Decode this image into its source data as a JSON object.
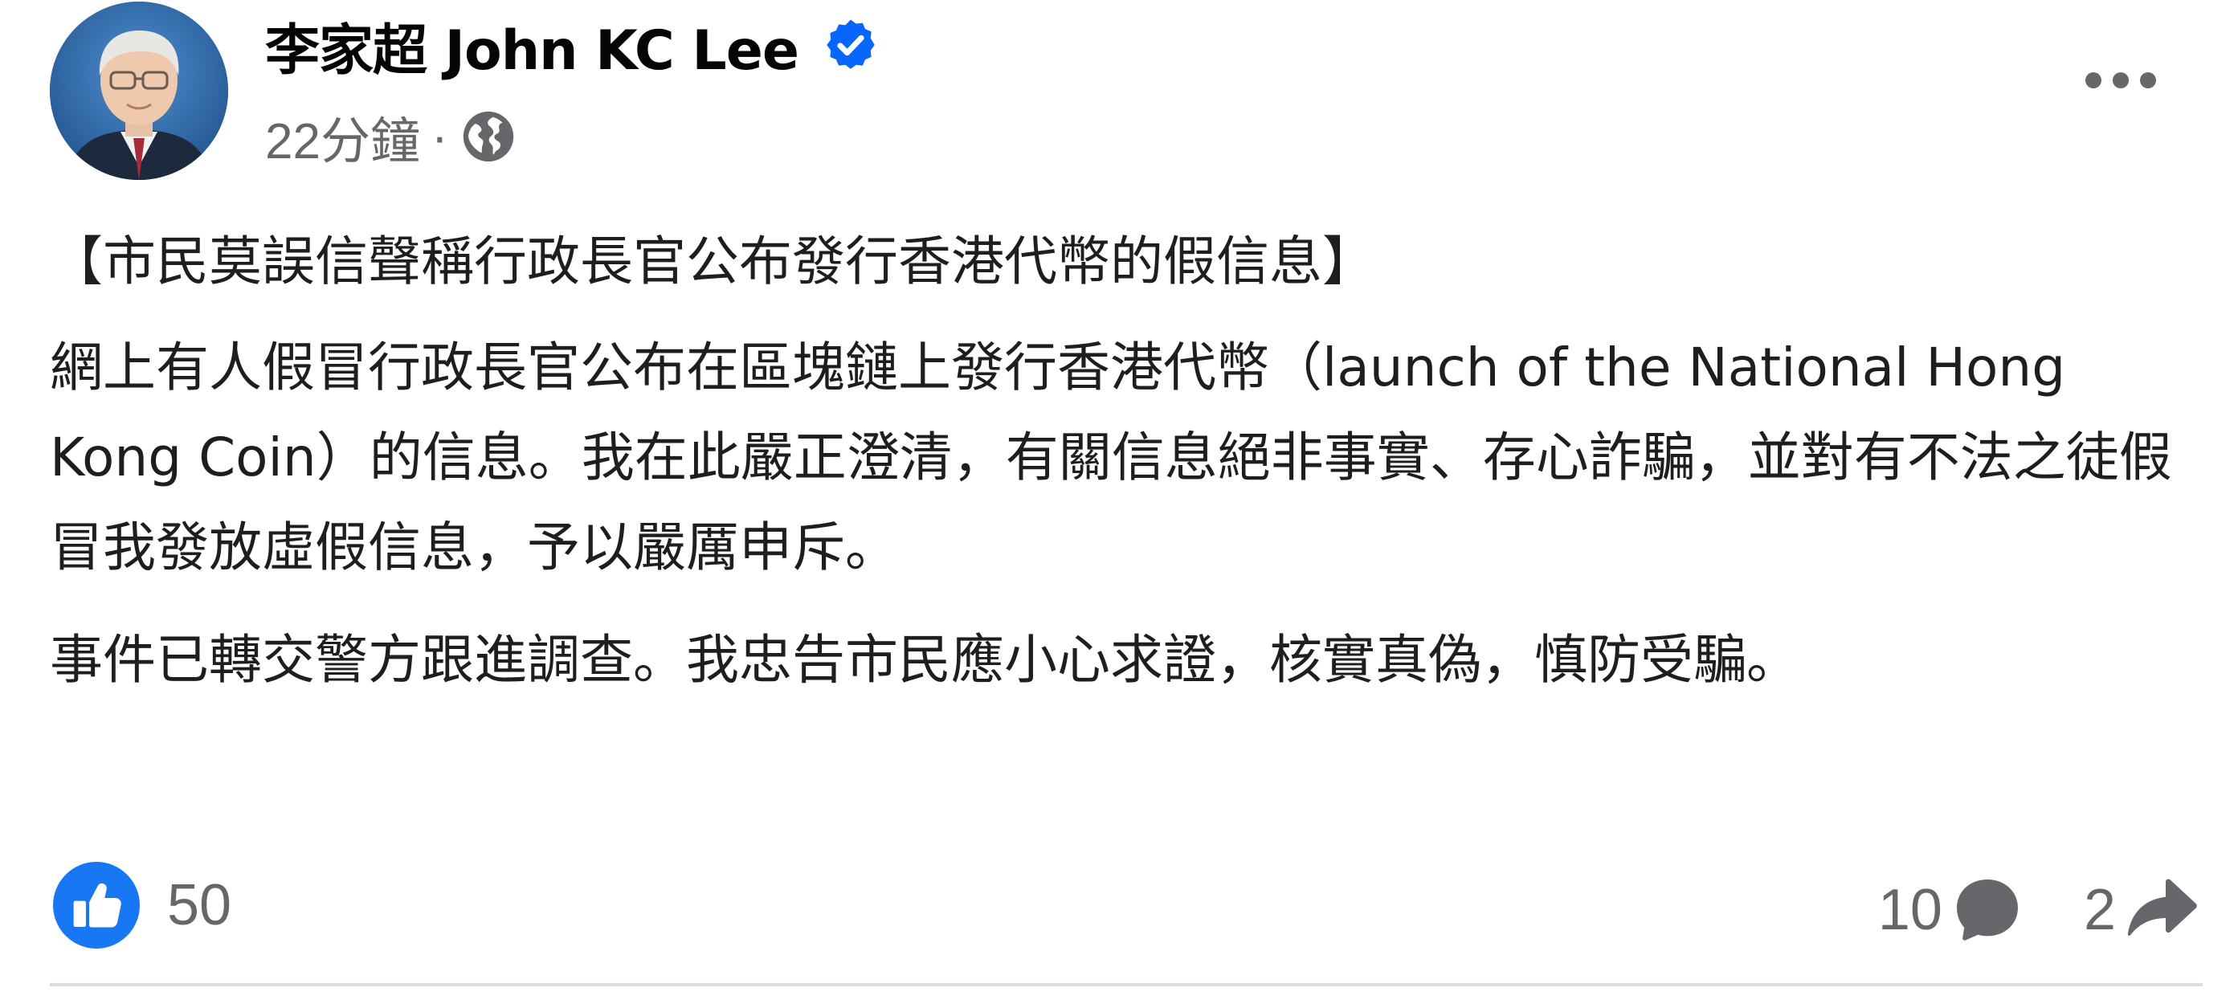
{
  "post": {
    "author": {
      "name": "李家超 John KC Lee",
      "verified": true
    },
    "meta": {
      "time": "22分鐘",
      "separator": "·",
      "privacy_icon": "globe-icon"
    },
    "more_icon": "more-options-icon",
    "title": "【市民莫誤信聲稱行政長官公布發行香港代幣的假信息】",
    "paragraphs": [
      "網上有人假冒行政長官公布在區塊鏈上發行香港代幣（launch of the National Hong Kong Coin）的信息。我在此嚴正澄清，有關信息絕非事實、存心詐騙，並對有不法之徒假冒我發放虛假信息，予以嚴厲申斥。",
      "事件已轉交警方跟進調查。我忠告市民應小心求證，核實真偽，慎防受騙。"
    ]
  },
  "engagement": {
    "reaction_icon": "like-icon",
    "reaction_count": "50",
    "comment_count": "10",
    "comment_icon": "comment-icon",
    "share_count": "2",
    "share_icon": "share-icon"
  },
  "colors": {
    "facebook_blue": "#0866ff",
    "secondary_text": "#65676b",
    "primary_text": "#1c1e21",
    "divider": "#dadde1"
  }
}
